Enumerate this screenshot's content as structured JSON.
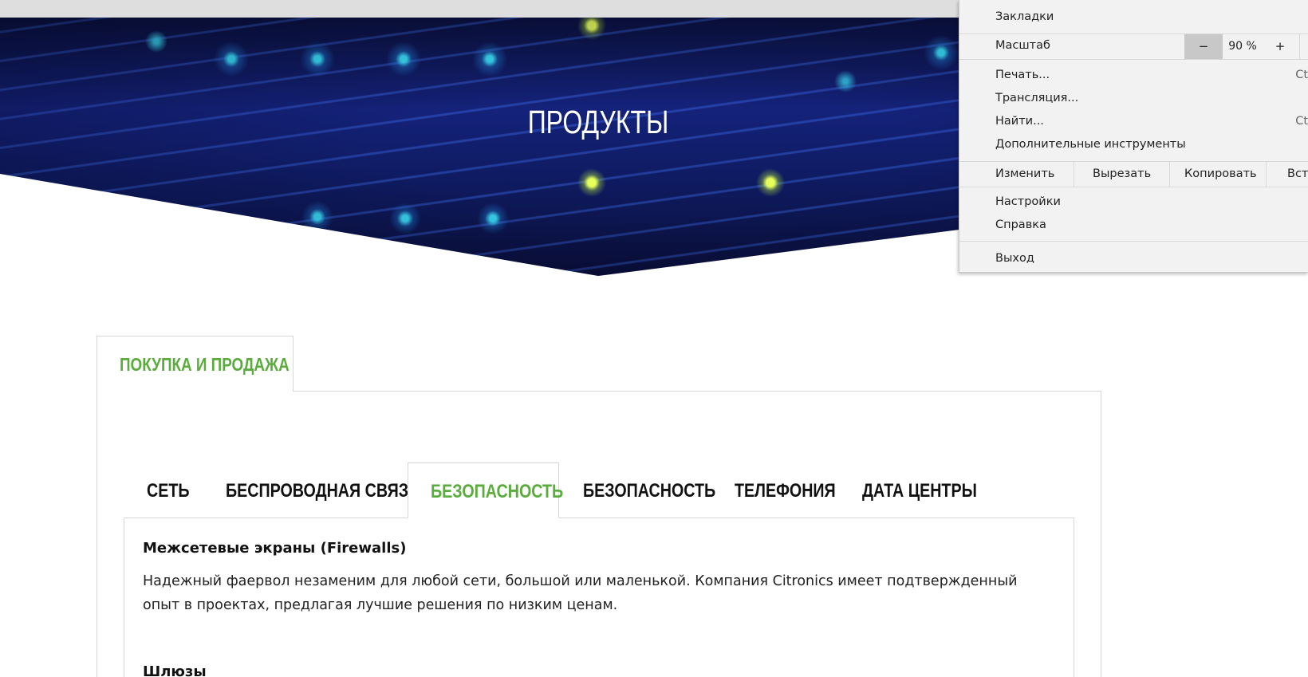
{
  "hero": {
    "title": "ПРОДУКТЫ"
  },
  "outer_tab": {
    "label": "ПОКУПКА И ПРОДАЖА"
  },
  "inner_tabs": [
    {
      "label": "СЕТЬ"
    },
    {
      "label": "БЕСПРОВОДНАЯ СВЯЗЬ"
    },
    {
      "label": "БЕЗОПАСНОСТЬ"
    },
    {
      "label": "БЕЗОПАСНОСТЬ"
    },
    {
      "label": "ТЕЛЕФОНИЯ"
    },
    {
      "label": "ДАТА ЦЕНТРЫ"
    }
  ],
  "active_inner_tab": "БЕЗОПАСНОСТЬ",
  "content": {
    "sections": [
      {
        "heading": "Межсетевые экраны (Firewalls)",
        "text": "Надежный фаервол незаменим для любой сети, большой или маленькой. Компания Citronics имеет подтвержденный опыт в проектах, предлагая лучшие решения по низким ценам."
      },
      {
        "heading": "Шлюзы"
      }
    ]
  },
  "browser_menu": {
    "bookmarks": "Закладки",
    "zoom_label": "Масштаб",
    "zoom_minus": "−",
    "zoom_value": "90 %",
    "zoom_plus": "+",
    "print": "Печать...",
    "print_shortcut": "Ctr",
    "cast": "Трансляция...",
    "find": "Найти...",
    "find_shortcut": "Ctr",
    "more_tools": "Дополнительные инструменты",
    "edit": "Изменить",
    "cut": "Вырезать",
    "copy": "Копировать",
    "paste": "Вста",
    "settings": "Настройки",
    "help": "Справка",
    "exit": "Выход"
  },
  "colors": {
    "accent_green": "#5aac3b",
    "menu_bg": "#f2f2f2",
    "hero_blue": "#14227a"
  }
}
